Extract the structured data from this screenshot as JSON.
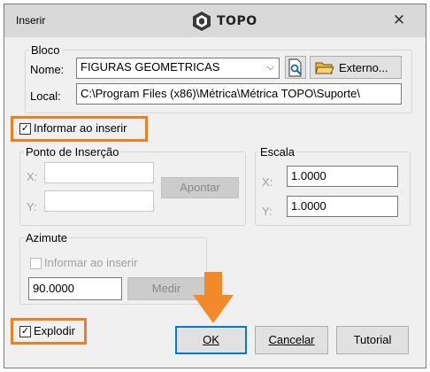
{
  "window": {
    "title": "Inserir",
    "logo_text": "TOPO",
    "close_icon": "close-icon"
  },
  "bloco": {
    "label": "Bloco",
    "nome_label": "Nome:",
    "nome_value": "FIGURAS GEOMETRICAS",
    "local_label": "Local:",
    "local_value": "C:\\Program Files (x86)\\Métrica\\Métrica TOPO\\Suporte\\",
    "externo_label": "Externo..."
  },
  "informar_inserir": {
    "label": "Informar ao inserir",
    "checked": true
  },
  "ponto": {
    "label": "Ponto de Inserção",
    "x_label": "X:",
    "y_label": "Y:",
    "x_value": "",
    "y_value": "",
    "apontar_label": "Apontar"
  },
  "escala": {
    "label": "Escala",
    "x_label": "X:",
    "y_label": "Y:",
    "x_value": "1.0000",
    "y_value": "1.0000"
  },
  "azimute": {
    "label": "Azimute",
    "informar_label": "Informar ao inserir",
    "informar_checked": false,
    "value": "90.0000",
    "medir_label": "Medir"
  },
  "explodir": {
    "label": "Explodir",
    "checked": true
  },
  "buttons": {
    "ok": "OK",
    "cancelar": "Cancelar",
    "tutorial": "Tutorial"
  },
  "colors": {
    "highlight": "#ef7d22",
    "arrow": "#f28a2a",
    "focus": "#0078d7"
  }
}
